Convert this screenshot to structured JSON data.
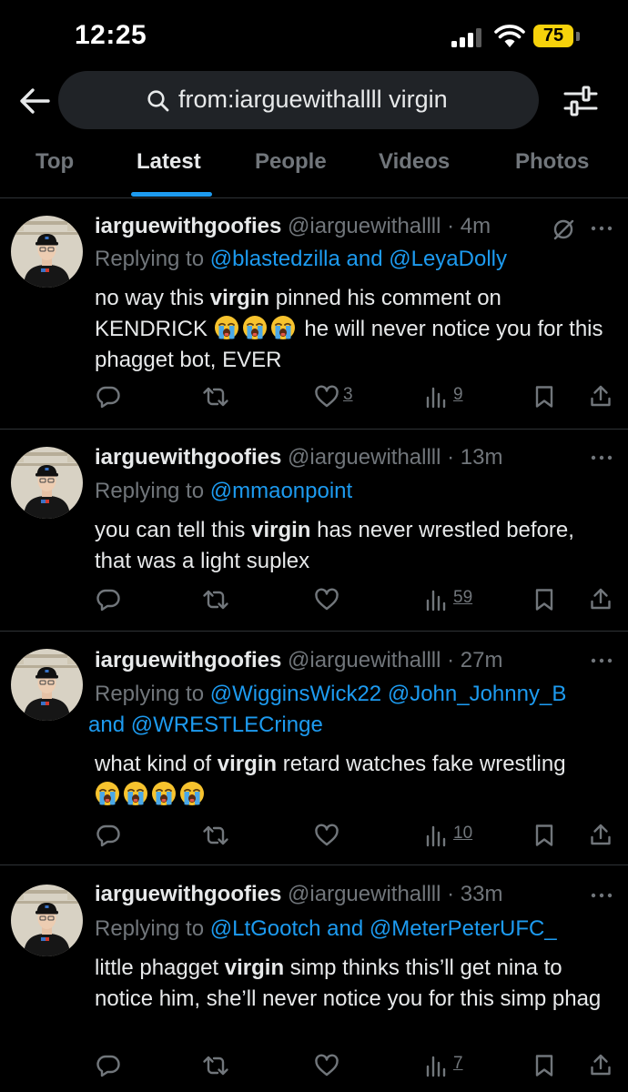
{
  "status_bar": {
    "time": "12:25",
    "battery": "75"
  },
  "search": {
    "query": "from:iarguewithallll virgin"
  },
  "tabs": [
    "Top",
    "Latest",
    "People",
    "Videos",
    "Photos"
  ],
  "active_tab": "Latest",
  "tweets": [
    {
      "name": "iarguewithgoofies",
      "handle": "@iarguewithallll",
      "time": "4m",
      "reply_prefix": "Replying to ",
      "reply_a": "@blastedzilla",
      "reply_and": " and ",
      "reply_b": "@LeyaDolly",
      "text_1": "no way this ",
      "text_bold": "virgin",
      "text_2": " pinned his comment on KENDRICK ",
      "text_3": " he will never notice you for this phagget bot, EVER",
      "likes": "3",
      "views": "9"
    },
    {
      "name": "iarguewithgoofies",
      "handle": "@iarguewithallll",
      "time": "13m",
      "reply_prefix": "Replying to ",
      "reply_a": "@mmaonpoint",
      "text_1": "you can tell this ",
      "text_bold": "virgin",
      "text_2": " has never wrestled before, that was a light suplex",
      "views": "59"
    },
    {
      "name": "iarguewithgoofies",
      "handle": "@iarguewithallll",
      "time": "27m",
      "reply_prefix": "Replying to ",
      "reply_a": "@WigginsWick22",
      "reply_sp": " ",
      "reply_b": "@John_Johnny_B",
      "reply_and": " and ",
      "reply_c": "@WRESTLECringe",
      "text_1": "what kind of ",
      "text_bold": "virgin",
      "text_2": " retard watches fake wrestling",
      "views": "10"
    },
    {
      "name": "iarguewithgoofies",
      "handle": "@iarguewithallll",
      "time": "33m",
      "reply_prefix": "Replying to ",
      "reply_a": "@LtGootch",
      "reply_and": " and ",
      "reply_b": "@MeterPeterUFC_",
      "text_1": "little phagget ",
      "text_bold": "virgin",
      "text_2": " simp thinks this’ll get nina to notice him, she’ll never notice you for this simp phag",
      "views": "7"
    }
  ],
  "dot_sep": " · ",
  "icons": {
    "back": "arrow-left-icon",
    "search": "search-icon",
    "filter": "sliders-icon",
    "more": "more-icon",
    "grok": "grok-icon",
    "reply": "reply-icon",
    "retweet": "retweet-icon",
    "like": "heart-icon",
    "views": "views-icon",
    "bookmark": "bookmark-icon",
    "share": "share-icon",
    "emoji": "loudly-crying-face-emoji"
  },
  "colors": {
    "background": "#000000",
    "accent": "#1d9bf0",
    "muted": "#71767b",
    "text": "#e7e9ea",
    "battery": "#f6d20b"
  }
}
